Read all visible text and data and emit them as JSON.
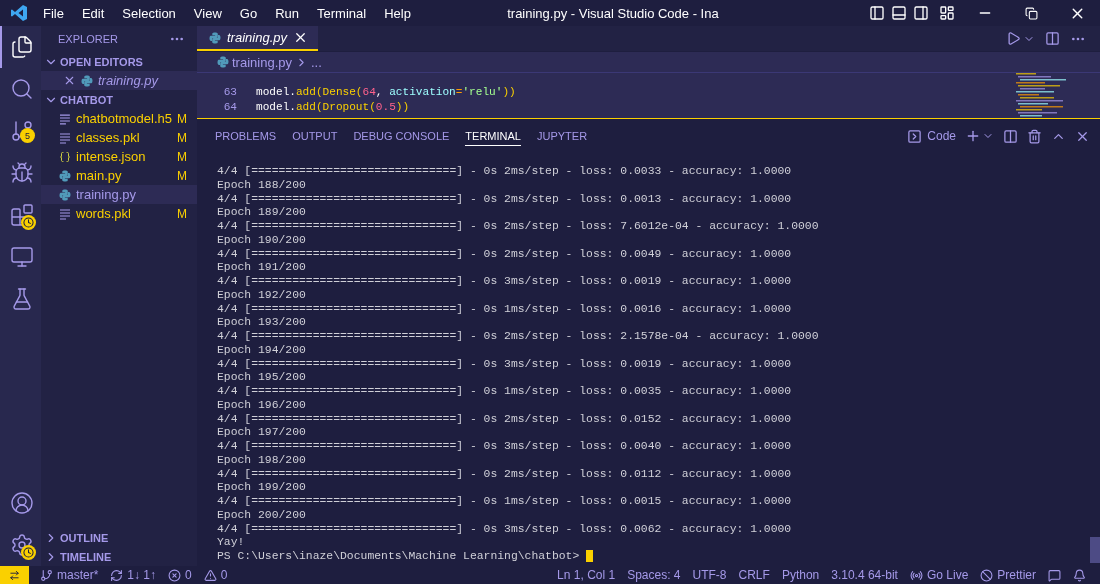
{
  "window": {
    "title": "training.py - Visual Studio Code - Ina",
    "menu": [
      "File",
      "Edit",
      "Selection",
      "View",
      "Go",
      "Run",
      "Terminal",
      "Help"
    ]
  },
  "activity_bar": {
    "items": [
      {
        "kind": "explorer",
        "selected": true,
        "pending": false
      },
      {
        "kind": "search",
        "selected": false,
        "pending": false
      },
      {
        "kind": "source-control",
        "selected": false,
        "pending": false,
        "badge": "5"
      },
      {
        "kind": "run-debug",
        "selected": false,
        "pending": false
      },
      {
        "kind": "extensions",
        "selected": false,
        "pending": true
      },
      {
        "kind": "remote",
        "selected": false,
        "pending": false
      },
      {
        "kind": "testing",
        "selected": false,
        "pending": false
      }
    ],
    "bottom": [
      {
        "kind": "account",
        "pending": false
      },
      {
        "kind": "settings",
        "pending": true
      }
    ]
  },
  "sidebar": {
    "title": "EXPLORER",
    "open_editors": {
      "label": "OPEN EDITORS",
      "expanded": true,
      "items": [
        {
          "name": "training.py",
          "kind": "python",
          "preview": true,
          "selected": true
        }
      ]
    },
    "folder": {
      "label": "CHATBOT",
      "expanded": true,
      "items": [
        {
          "name": "chatbotmodel.h5",
          "kind": "text",
          "status": "M",
          "selected": false
        },
        {
          "name": "classes.pkl",
          "kind": "text",
          "status": "M",
          "selected": false
        },
        {
          "name": "intense.json",
          "kind": "json",
          "status": "M",
          "selected": false
        },
        {
          "name": "main.py",
          "kind": "python",
          "status": "M",
          "selected": false
        },
        {
          "name": "training.py",
          "kind": "python",
          "selected": true
        },
        {
          "name": "words.pkl",
          "kind": "text",
          "status": "M",
          "selected": false
        }
      ]
    },
    "sections": [
      {
        "label": "OUTLINE",
        "expanded": false
      },
      {
        "label": "TIMELINE",
        "expanded": false
      }
    ]
  },
  "editor": {
    "tabs": [
      {
        "label": "training.py",
        "kind": "python",
        "selected": true,
        "preview": true
      }
    ],
    "breadcrumb": [
      "training.py",
      "..."
    ],
    "lines": [
      {
        "number": "63",
        "tokens": [
          {
            "text": "model.",
            "kind": "plain"
          },
          {
            "text": "add(Dense(",
            "kind": "call"
          },
          {
            "text": "64",
            "kind": "number"
          },
          {
            "text": ", ",
            "kind": "plain"
          },
          {
            "text": "activation",
            "kind": "param"
          },
          {
            "text": "=",
            "kind": "operator"
          },
          {
            "text": "'relu'",
            "kind": "string"
          },
          {
            "text": "))",
            "kind": "call"
          }
        ]
      },
      {
        "number": "64",
        "tokens": [
          {
            "text": "model.",
            "kind": "plain"
          },
          {
            "text": "add(Dropout(",
            "kind": "call"
          },
          {
            "text": "0.5",
            "kind": "number"
          },
          {
            "text": "))",
            "kind": "call"
          }
        ]
      }
    ]
  },
  "panel": {
    "tabs": [
      {
        "label": "PROBLEMS",
        "selected": false
      },
      {
        "label": "OUTPUT",
        "selected": false
      },
      {
        "label": "DEBUG CONSOLE",
        "selected": false
      },
      {
        "label": "TERMINAL",
        "selected": true
      },
      {
        "label": "JUPYTER",
        "selected": false
      }
    ],
    "profile": "Code",
    "terminal": {
      "lines": [
        "4/4 [==============================] - 0s 2ms/step - loss: 0.0033 - accuracy: 1.0000",
        "Epoch 188/200",
        "4/4 [==============================] - 0s 2ms/step - loss: 0.0013 - accuracy: 1.0000",
        "Epoch 189/200",
        "4/4 [==============================] - 0s 2ms/step - loss: 7.6012e-04 - accuracy: 1.0000",
        "Epoch 190/200",
        "4/4 [==============================] - 0s 2ms/step - loss: 0.0049 - accuracy: 1.0000",
        "Epoch 191/200",
        "4/4 [==============================] - 0s 3ms/step - loss: 0.0019 - accuracy: 1.0000",
        "Epoch 192/200",
        "4/4 [==============================] - 0s 1ms/step - loss: 0.0016 - accuracy: 1.0000",
        "Epoch 193/200",
        "4/4 [==============================] - 0s 2ms/step - loss: 2.1578e-04 - accuracy: 1.0000",
        "Epoch 194/200",
        "4/4 [==============================] - 0s 3ms/step - loss: 0.0019 - accuracy: 1.0000",
        "Epoch 195/200",
        "4/4 [==============================] - 0s 1ms/step - loss: 0.0035 - accuracy: 1.0000",
        "Epoch 196/200",
        "4/4 [==============================] - 0s 2ms/step - loss: 0.0152 - accuracy: 1.0000",
        "Epoch 197/200",
        "4/4 [==============================] - 0s 3ms/step - loss: 0.0040 - accuracy: 1.0000",
        "Epoch 198/200",
        "4/4 [==============================] - 0s 2ms/step - loss: 0.0112 - accuracy: 1.0000",
        "Epoch 199/200",
        "4/4 [==============================] - 0s 1ms/step - loss: 0.0015 - accuracy: 1.0000",
        "Epoch 200/200",
        "4/4 [==============================] - 0s 3ms/step - loss: 0.0062 - accuracy: 1.0000",
        "Yay!"
      ],
      "prompt": "PS C:\\Users\\inaze\\Documents\\Machine Learning\\chatbot>"
    }
  },
  "status_bar": {
    "left": [
      {
        "kind": "remote"
      },
      {
        "kind": "branch",
        "text": "master*"
      },
      {
        "kind": "sync",
        "text": "1↓ 1↑"
      },
      {
        "kind": "errors",
        "text": "0"
      },
      {
        "kind": "warnings",
        "text": "0"
      }
    ],
    "right": [
      {
        "kind": "plain",
        "text": "Ln 1, Col 1"
      },
      {
        "kind": "plain",
        "text": "Spaces: 4"
      },
      {
        "kind": "plain",
        "text": "UTF-8"
      },
      {
        "kind": "plain",
        "text": "CRLF"
      },
      {
        "kind": "plain",
        "text": "Python"
      },
      {
        "kind": "plain",
        "text": "3.10.4 64-bit"
      },
      {
        "kind": "live",
        "text": "Go Live"
      },
      {
        "kind": "prettier",
        "text": "Prettier"
      },
      {
        "kind": "feedback"
      },
      {
        "kind": "notifications"
      }
    ]
  }
}
